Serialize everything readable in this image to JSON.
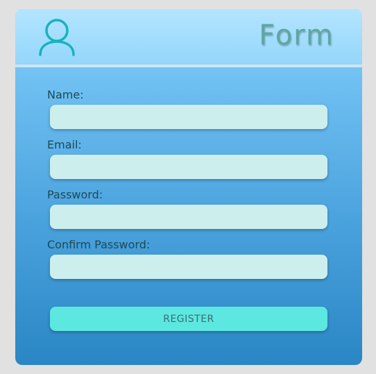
{
  "header": {
    "title": "Form",
    "icon": "user-icon"
  },
  "form": {
    "fields": [
      {
        "label": "Name:",
        "value": "",
        "type": "text"
      },
      {
        "label": "Email:",
        "value": "",
        "type": "email"
      },
      {
        "label": "Password:",
        "value": "",
        "type": "password"
      },
      {
        "label": "Confirm Password:",
        "value": "",
        "type": "password"
      }
    ],
    "submit_label": "REGISTER"
  },
  "colors": {
    "page_background": "#e1e1e1",
    "header": "#a9e0fe",
    "input_background": "#ccefee",
    "button_background": "#5ce8e0",
    "title": "#5fa6a1",
    "icon_stroke": "#16b4bd",
    "label_text": "#1d4a52"
  }
}
